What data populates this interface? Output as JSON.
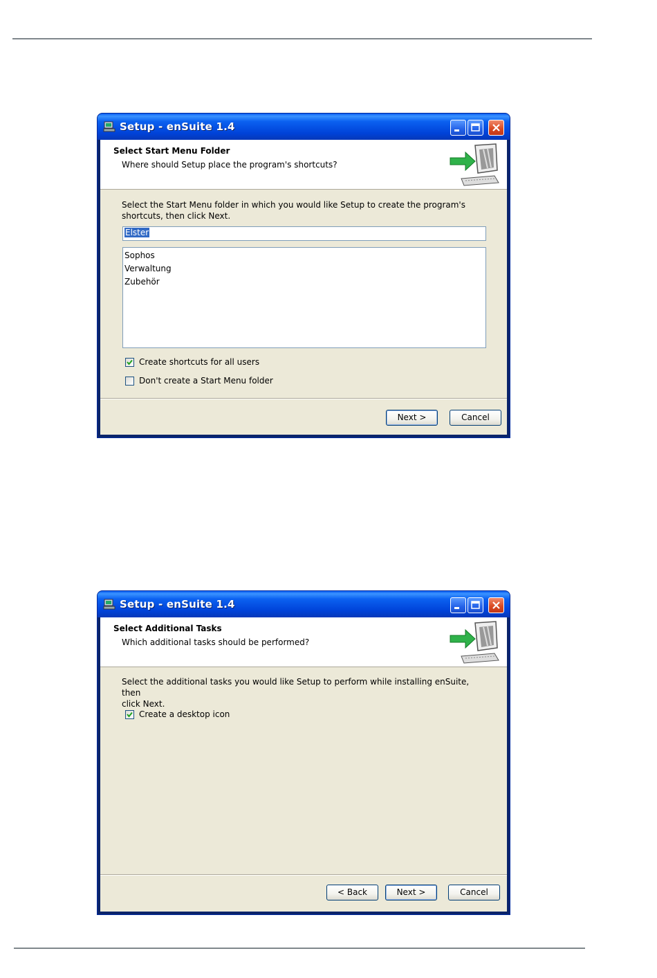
{
  "window1": {
    "title": "Setup - enSuite 1.4",
    "header_title": "Select Start Menu Folder",
    "header_subtitle": "Where should Setup place the program's shortcuts?",
    "description_line1": "Select the Start Menu folder in which you would like Setup to create the program's",
    "description_line2": "shortcuts, then click Next.",
    "folder_input_value": "Elster",
    "folder_list": [
      "Sophos",
      "Verwaltung",
      "Zubehör"
    ],
    "checkbox_all_users": {
      "label": "Create shortcuts for all users",
      "checked": true
    },
    "checkbox_no_folder": {
      "label": "Don't create a Start Menu folder",
      "checked": false
    },
    "next_label": "Next >",
    "cancel_label": "Cancel"
  },
  "window2": {
    "title": "Setup - enSuite 1.4",
    "header_title": "Select Additional Tasks",
    "header_subtitle": "Which additional tasks should be performed?",
    "description_line1": "Select the additional tasks you would like Setup to perform while installing enSuite, then",
    "description_line2": "click Next.",
    "checkbox_desktop_icon": {
      "label": "Create a desktop icon",
      "checked": true
    },
    "back_label": "< Back",
    "next_label": "Next >",
    "cancel_label": "Cancel"
  },
  "icons": [
    "setup-app-icon",
    "minimize-icon",
    "maximize-icon",
    "close-icon",
    "setup-computer-arrow-icon",
    "checkmark-icon"
  ],
  "colors": {
    "titlebar": "#0b61f0",
    "dialog_bg": "#ece9d8",
    "selection": "#316ac5",
    "close_button": "#d9471e"
  }
}
